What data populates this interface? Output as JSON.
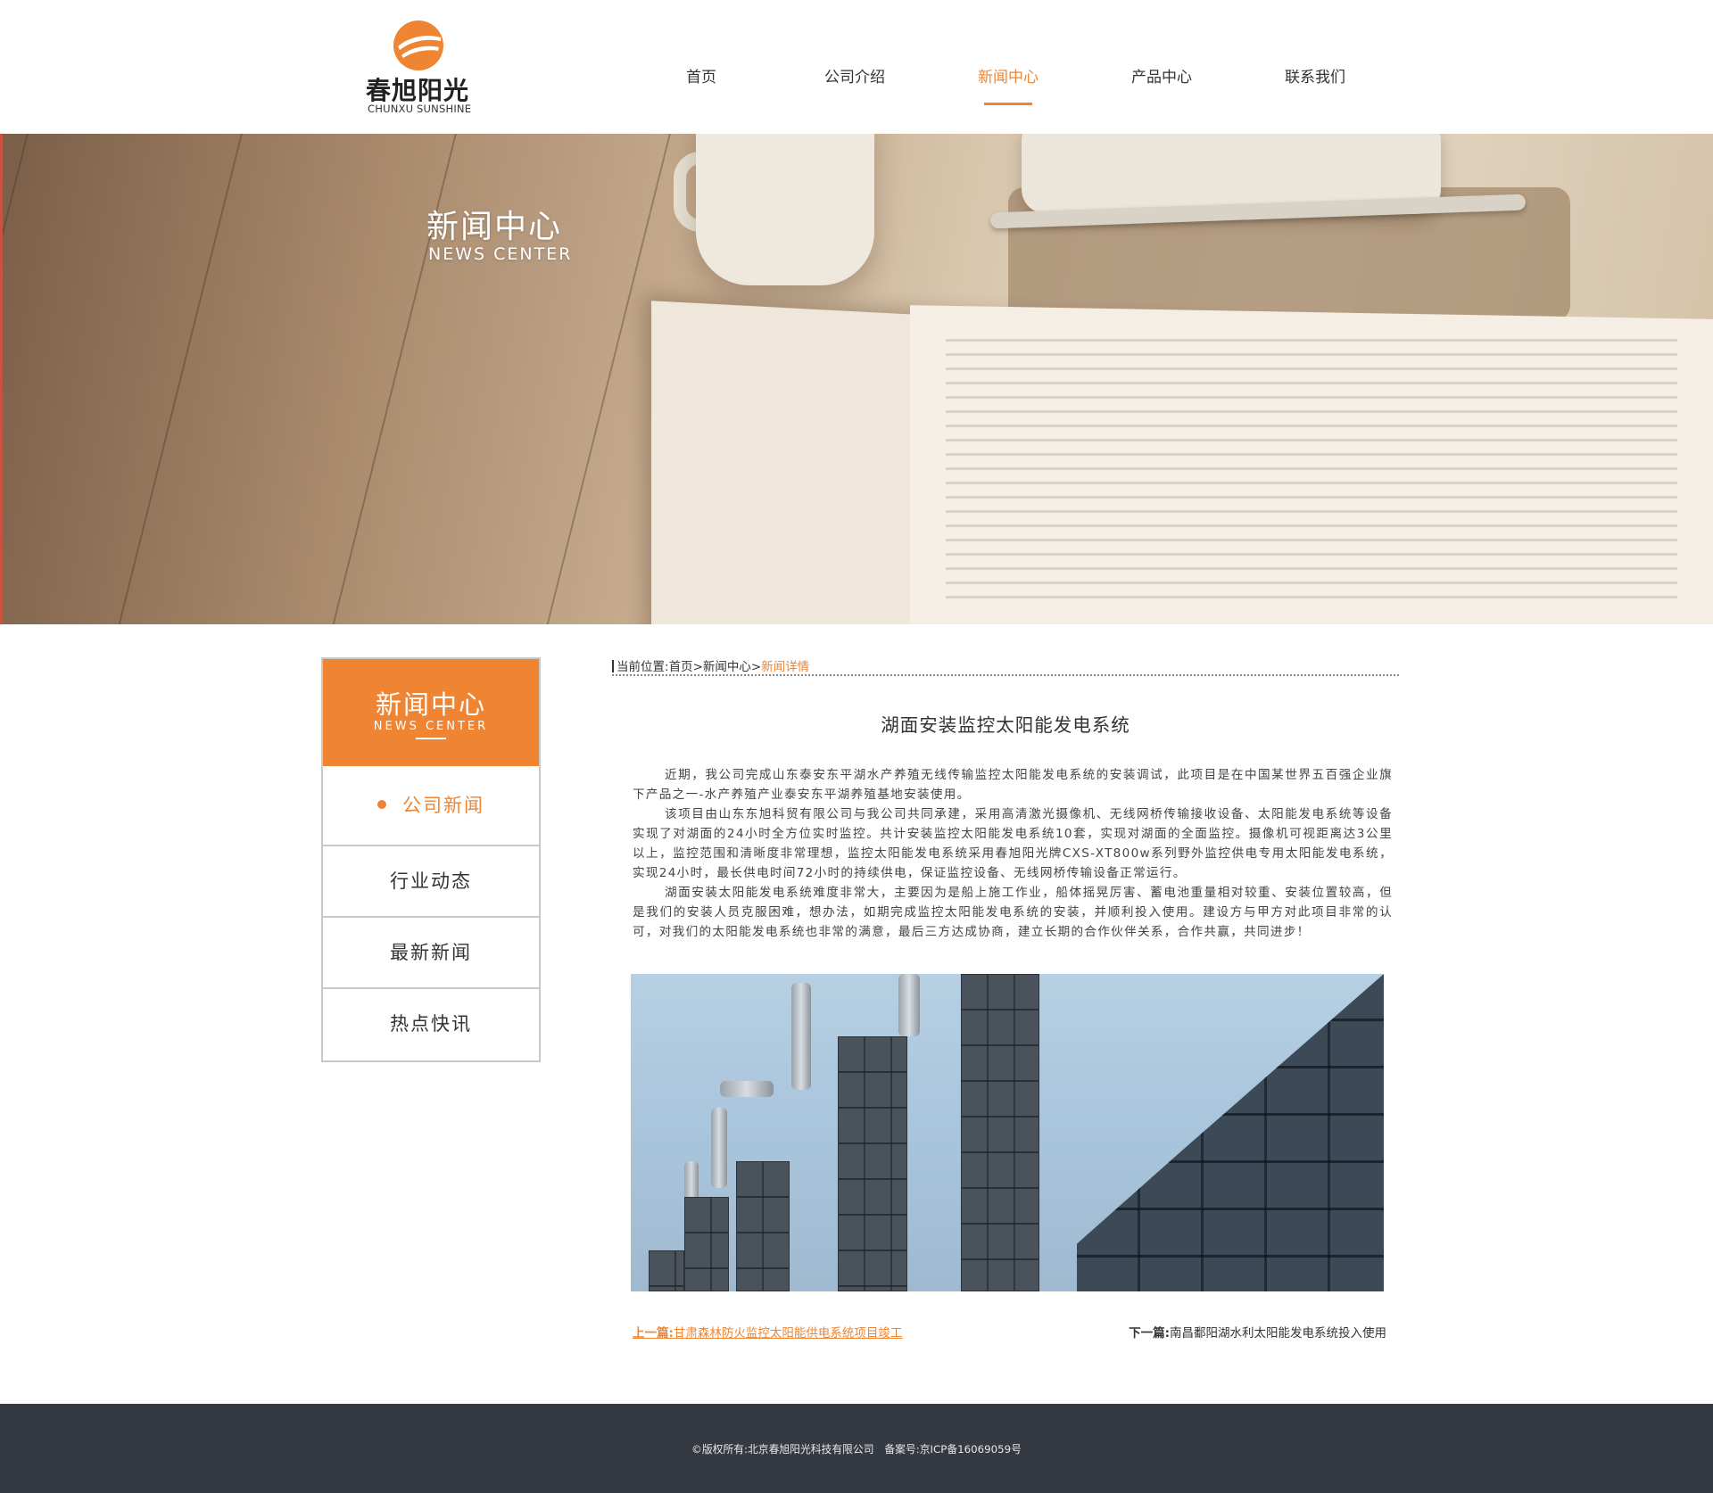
{
  "brand": {
    "name_cn": "春旭阳光",
    "name_en": "CHUNXU SUNSHINE",
    "accent": "#ef8532"
  },
  "nav": {
    "items": [
      {
        "label": "首页",
        "active": false
      },
      {
        "label": "公司介绍",
        "active": false
      },
      {
        "label": "新闻中心",
        "active": true
      },
      {
        "label": "产品中心",
        "active": false
      },
      {
        "label": "联系我们",
        "active": false
      }
    ]
  },
  "banner": {
    "title": "新闻中心",
    "subtitle": "NEWS CENTER"
  },
  "sidebar": {
    "title": "新闻中心",
    "subtitle": "NEWS CENTER",
    "items": [
      {
        "label": "公司新闻",
        "active": true
      },
      {
        "label": "行业动态",
        "active": false
      },
      {
        "label": "最新新闻",
        "active": false
      },
      {
        "label": "热点快讯",
        "active": false
      }
    ]
  },
  "breadcrumb": {
    "prefix": "当前位置:",
    "home": "首页",
    "sep": ">",
    "section": "新闻中心",
    "current": "新闻详情"
  },
  "article": {
    "title": "湖面安装监控太阳能发电系统",
    "paragraphs": [
      "近期，我公司完成山东泰安东平湖水产养殖无线传输监控太阳能发电系统的安装调试，此项目是在中国某世界五百强企业旗下产品之一-水产养殖产业泰安东平湖养殖基地安装使用。",
      "该项目由山东东旭科贸有限公司与我公司共同承建，采用高清激光摄像机、无线网桥传输接收设备、太阳能发电系统等设备实现了对湖面的24小时全方位实时监控。共计安装监控太阳能发电系统10套，实现对湖面的全面监控。摄像机可视距离达3公里以上，监控范围和清晰度非常理想，监控太阳能发电系统采用春旭阳光牌CXS-XT800w系列野外监控供电专用太阳能发电系统，实现24小时，最长供电时间72小时的持续供电，保证监控设备、无线网桥传输设备正常运行。",
      "湖面安装太阳能发电系统难度非常大，主要因为是船上施工作业，船体摇晃厉害、蓄电池重量相对较重、安装位置较高，但是我们的安装人员克服困难，想办法，如期完成监控太阳能发电系统的安装，并顺利投入使用。建设方与甲方对此项目非常的认可，对我们的太阳能发电系统也非常的满意，最后三方达成协商，建立长期的合作伙伴关系，合作共赢，共同进步！"
    ]
  },
  "pager": {
    "prev_label": "上一篇:",
    "prev_title": "甘肃森林防火监控太阳能供电系统项目竣工",
    "next_label": "下一篇:",
    "next_title": "南昌鄱阳湖水利太阳能发电系统投入使用"
  },
  "footer": {
    "copyright": "©版权所有:北京春旭阳光科技有限公司　备案号:京ICP备16069059号"
  }
}
